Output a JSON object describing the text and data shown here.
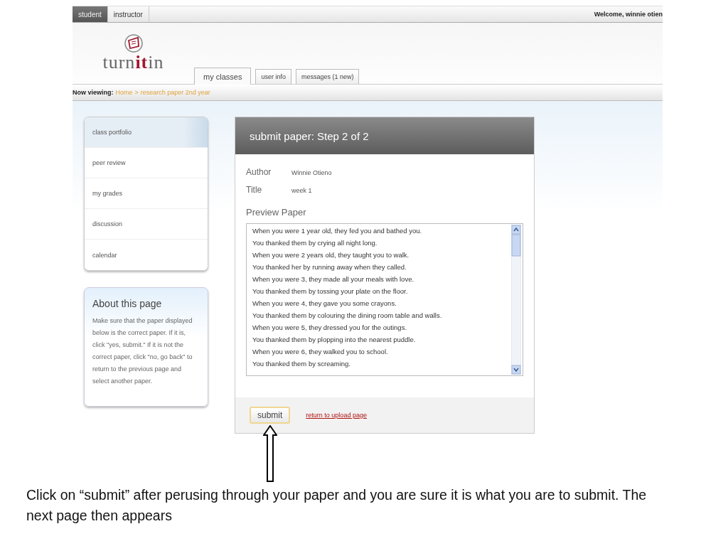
{
  "role_tabs": [
    {
      "label": "student",
      "selected": true
    },
    {
      "label": "instructor",
      "selected": false
    }
  ],
  "welcome": "Welcome, winnie otien",
  "logo": "turn**it**in",
  "nav_tabs": [
    {
      "label": "my classes",
      "selected": true
    },
    {
      "label": "user info",
      "selected": false
    },
    {
      "label": "messages (1 new)",
      "selected": false
    }
  ],
  "breadcrumb": {
    "label": "Now viewing:",
    "home": "Home",
    "separator": ">",
    "current": "research paper 2nd year"
  },
  "sidebar": {
    "items": [
      {
        "label": "class portfolio",
        "selected": true
      },
      {
        "label": "peer review",
        "selected": false
      },
      {
        "label": "my grades",
        "selected": false
      },
      {
        "label": "discussion",
        "selected": false
      },
      {
        "label": "calendar",
        "selected": false
      }
    ]
  },
  "about": {
    "title": "About this page",
    "text": "Make sure that the paper displayed below is the correct paper. If it is, click \"yes, submit.\" If it is not the correct paper, click \"no, go back\" to return to the previous page and select another paper."
  },
  "panel": {
    "title": "submit paper: Step 2 of 2",
    "fields": [
      {
        "label": "Author",
        "value": "Winnie Otieno"
      },
      {
        "label": "Title",
        "value": "week 1"
      }
    ],
    "preview_label": "Preview Paper",
    "preview_lines": [
      "When you were 1 year old, they fed you and bathed you.",
      "You thanked them by crying all night long.",
      "When you were 2 years old, they taught you to walk.",
      "You thanked her by running away when they called.",
      "When you were 3, they made all your meals with love.",
      "You thanked them by tossing your plate on the floor.",
      "When you were 4, they gave you some crayons.",
      "You thanked them by colouring the dining room table and walls.",
      "When you were 5, they dressed you for the outings.",
      "You thanked them by plopping into the nearest puddle.",
      "When you were 6, they walked you to school.",
      "You thanked them by screaming."
    ],
    "submit": "submit",
    "return_link": "return to upload page"
  },
  "caption": "Click on “submit” after perusing through your paper and you are sure it is what you are to submit. The next page then appears"
}
